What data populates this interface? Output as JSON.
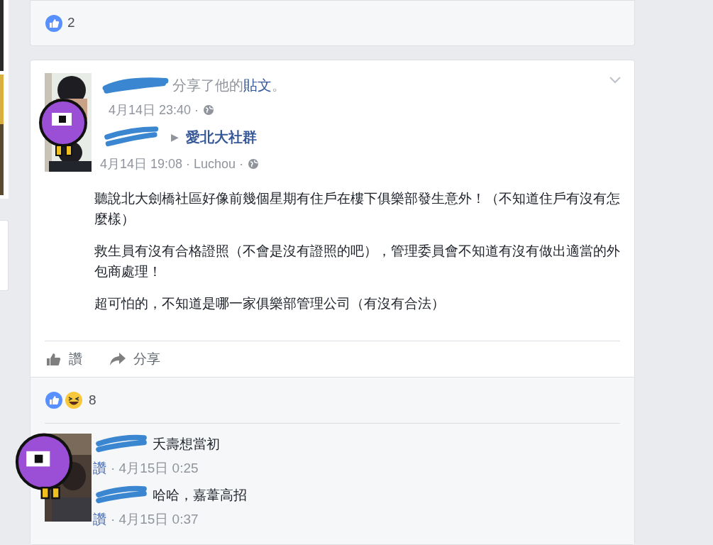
{
  "top_card": {
    "like_count": "2"
  },
  "post": {
    "share_line": {
      "verb": "分享了他的",
      "link": "貼文",
      "end": "。"
    },
    "share_time": "4月14日 23:40 ·",
    "original": {
      "arrow": "▶",
      "group": "愛北大社群",
      "meta": "4月14日 19:08 · Luchou ·"
    },
    "paragraphs": [
      "聽說北大劍橋社區好像前幾個星期有住戶在樓下俱樂部發生意外！（不知道住戶有沒有怎麼樣）",
      "救生員有沒有合格證照（不會是沒有證照的吧），管理委員會不知道有沒有做出適當的外包商處理！",
      "超可怕的，不知道是哪一家俱樂部管理公司（有沒有合法）"
    ],
    "actions": [
      {
        "kind": "like",
        "label": "讚"
      },
      {
        "kind": "share",
        "label": "分享"
      }
    ],
    "reactions": {
      "count": "8"
    },
    "comments": [
      {
        "text": "夭壽想當初",
        "like": "讚",
        "time": "· 4月15日 0:25"
      },
      {
        "text": "哈哈，嘉葦高招",
        "like": "讚",
        "time": "· 4月15日 0:37"
      }
    ]
  }
}
